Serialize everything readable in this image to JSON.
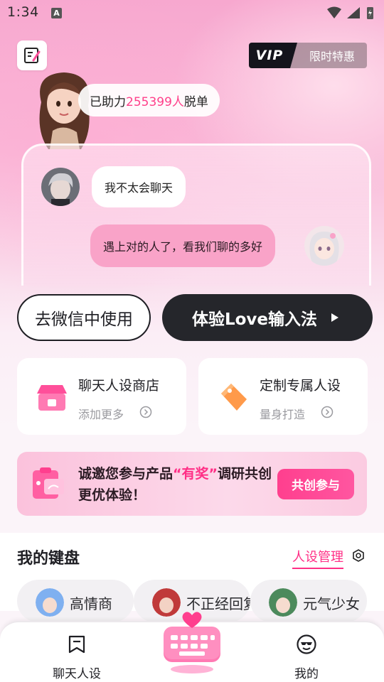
{
  "status_bar": {
    "time": "1:34",
    "notification_glyph": "A"
  },
  "header": {
    "vip_badge": "VIP",
    "vip_label": "限时特惠"
  },
  "stat": {
    "prefix": "已助力",
    "count": "255399人",
    "suffix": "脱单"
  },
  "chat": {
    "received": "我不太会聊天",
    "sent": "遇上对的人了，看我们聊的多好"
  },
  "actions": {
    "wechat": "去微信中使用",
    "love": "体验Love输入法"
  },
  "features": [
    {
      "title": "聊天人设商店",
      "sub": "添加更多",
      "icon": "shop-icon"
    },
    {
      "title": "定制专属人设",
      "sub": "量身打造",
      "icon": "tag-icon"
    }
  ],
  "survey": {
    "text_a": "诚邀您参与产品",
    "highlight": "“有奖”",
    "text_b": "调研共创更优体验！",
    "button": "共创参与"
  },
  "keyboard": {
    "title": "我的键盘",
    "manage": "人设管理",
    "chips": [
      "高情商",
      "不正经回复",
      "元气少女"
    ]
  },
  "nav": {
    "left": "聊天人设",
    "right": "我的"
  },
  "colors": {
    "accent": "#ff2f86",
    "dark_button": "#25262b",
    "sent_bubble": "#f9a3c8"
  }
}
